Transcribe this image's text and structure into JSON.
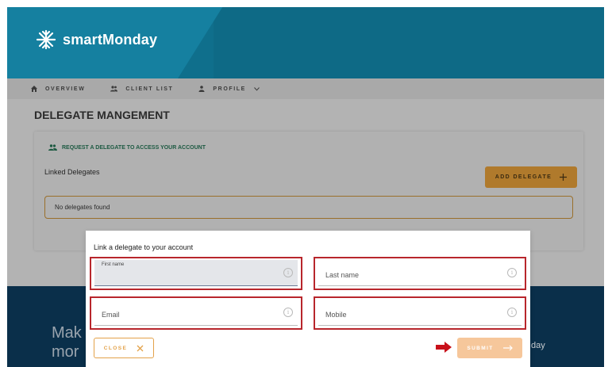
{
  "app": {
    "brand": "smartMonday"
  },
  "nav": {
    "items": [
      {
        "label": "OVERVIEW",
        "icon": "home-icon"
      },
      {
        "label": "CLIENT LIST",
        "icon": "people-icon"
      },
      {
        "label": "PROFILE",
        "icon": "person-icon"
      }
    ]
  },
  "page": {
    "title": "DELEGATE MANGEMENT"
  },
  "card": {
    "request_link": "REQUEST A DELEGATE TO ACCESS YOUR ACCOUNT",
    "linked_label": "Linked Delegates",
    "add_button": "ADD DELEGATE",
    "empty_message": "No delegates found"
  },
  "band": {
    "line1": "Mak",
    "line2": "mor",
    "right_text": "day"
  },
  "modal": {
    "title": "Link a delegate to your account",
    "fields": {
      "first_name": "First name",
      "last_name": "Last name",
      "email": "Email",
      "mobile": "Mobile"
    },
    "close_button": "CLOSE",
    "submit_button": "SUBMIT"
  },
  "colors": {
    "header": "#0e6a86",
    "accent": "#e3a24a",
    "highlight": "#b8262c",
    "band": "#0a2f4a"
  }
}
